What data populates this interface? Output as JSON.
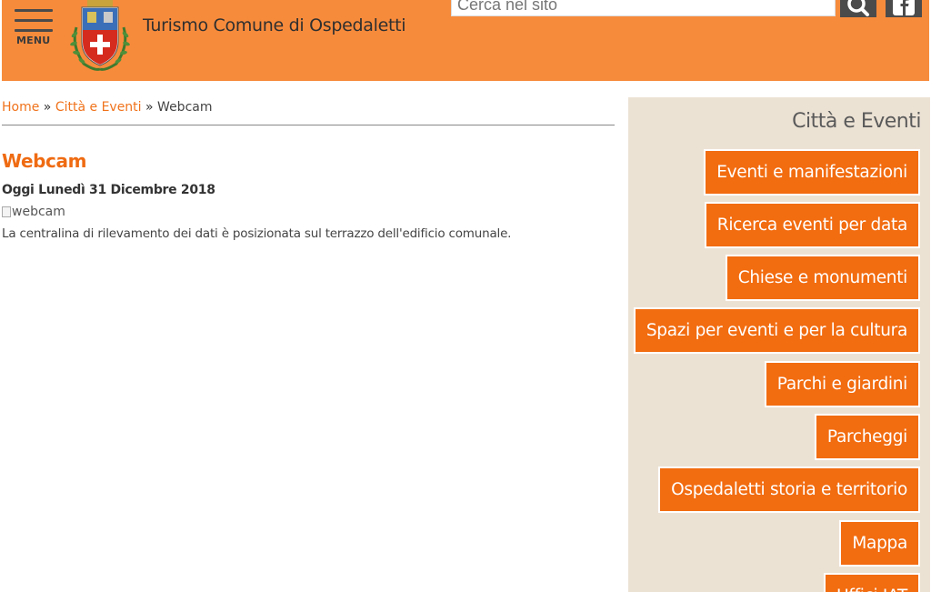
{
  "header": {
    "menu_label": "MENU",
    "site_title": "Turismo Comune di Ospedaletti",
    "search_placeholder": "Cerca nel sito",
    "accent_color": "#f78b3c",
    "icons": [
      "menu-icon",
      "coat-of-arms-logo",
      "search-icon",
      "facebook-icon"
    ]
  },
  "breadcrumb": {
    "home": "Home",
    "sep1": "»",
    "section": "Città e Eventi",
    "sep2": "»",
    "current": "Webcam"
  },
  "main": {
    "title": "Webcam",
    "today": "Oggi Lunedì 31 Dicembre 2018",
    "image_alt": "webcam",
    "description": "La centralina di rilevamento dei dati è posizionata sul terrazzo dell'edificio comunale."
  },
  "sidebar": {
    "title": "Città e Eventi",
    "button_color": "#f26c10",
    "background_color": "#ece2d4",
    "items": [
      {
        "label": "Eventi e manifestazioni"
      },
      {
        "label": "Ricerca eventi per data"
      },
      {
        "label": "Chiese e monumenti"
      },
      {
        "label": "Spazi per eventi e per la cultura"
      },
      {
        "label": "Parchi e giardini"
      },
      {
        "label": "Parcheggi"
      },
      {
        "label": "Ospedaletti storia e territorio"
      },
      {
        "label": "Mappa"
      },
      {
        "label": "Uffici IAT"
      }
    ]
  }
}
